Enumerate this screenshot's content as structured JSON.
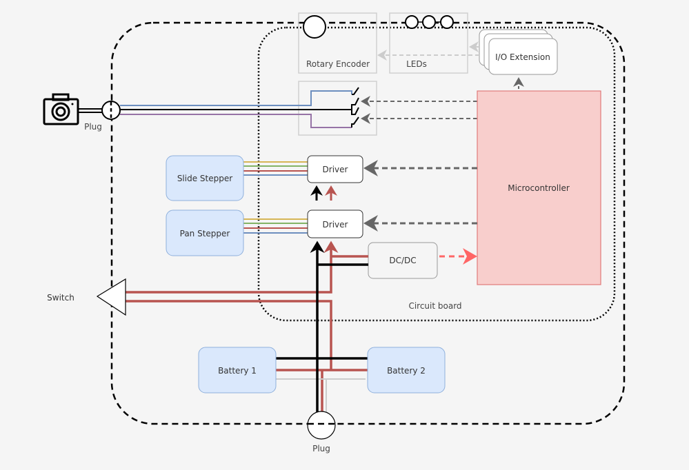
{
  "labels": {
    "rotary_encoder": "Rotary Encoder",
    "leds": "LEDs",
    "io_extension": "I/O Extension",
    "microcontroller": "Microcontroller",
    "plug_camera": "Plug",
    "slide_stepper": "Slide Stepper",
    "pan_stepper": "Pan Stepper",
    "driver_1": "Driver",
    "driver_2": "Driver",
    "dcdc": "DC/DC",
    "switch": "Switch",
    "circuit_board": "Circuit board",
    "battery_1": "Battery 1",
    "battery_2": "Battery 2",
    "plug_bottom": "Plug"
  },
  "colors": {
    "stepper_box_fill": "#dae8fc",
    "stepper_box_stroke": "#8fb0dc",
    "mcu_fill": "#f8cecc",
    "mcu_stroke": "#e07a7a",
    "power_red": "#b85450",
    "wire_blue": "#6c8ebf",
    "wire_purple": "#9673a6",
    "wire_yellow": "#d6b656",
    "wire_green": "#82b366",
    "signal_dash": "#666666",
    "dcdc_arrow": "#ff6666"
  },
  "icons": [
    "camera-icon",
    "switch-icon",
    "plug-icon"
  ]
}
